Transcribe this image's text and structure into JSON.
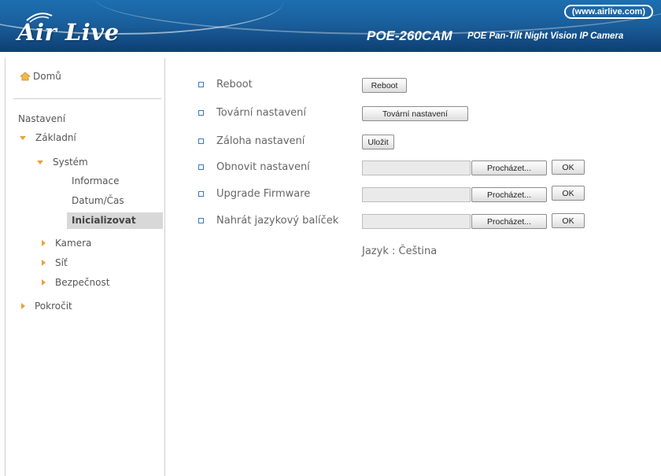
{
  "header": {
    "logo": "Air Live",
    "url": "(www.airlive.com)",
    "model": "POE-260CAM",
    "description": "POE Pan-Tilt Night Vision IP Camera"
  },
  "sidebar": {
    "home": "Domů",
    "section": "Nastavení",
    "items": {
      "zakladni": "Základní",
      "system": "Systém",
      "informace": "Informace",
      "datum": "Datum/Čas",
      "inicializovat": "Inicializovat",
      "kamera": "Kamera",
      "sit": "Síť",
      "bezpecnost": "Bezpečnost",
      "pokrocit": "Pokročit"
    }
  },
  "main": {
    "reboot": {
      "label": "Reboot",
      "button": "Reboot"
    },
    "factory": {
      "label": "Tovární nastavení",
      "button": "Tovární nastavení"
    },
    "backup": {
      "label": "Záloha nastavení",
      "button": "Uložit"
    },
    "restore": {
      "label": "Obnovit nastavení",
      "browse": "Procházet...",
      "ok": "OK"
    },
    "firmware": {
      "label": "Upgrade Firmware",
      "browse": "Procházet...",
      "ok": "OK"
    },
    "language": {
      "label": "Nahrát jazykový balíček",
      "browse": "Procházet...",
      "ok": "OK"
    },
    "current_language": "Jazyk : Čeština"
  },
  "colors": {
    "header_blue": "#1a5f9c",
    "arrow": "#e7a23b",
    "bullet": "#3a78c3",
    "active_bg": "#d8d8d8"
  },
  "icons": [
    "home-icon",
    "wave-icon",
    "arrow-down-icon",
    "arrow-right-icon",
    "checkbox-bullet-icon"
  ]
}
